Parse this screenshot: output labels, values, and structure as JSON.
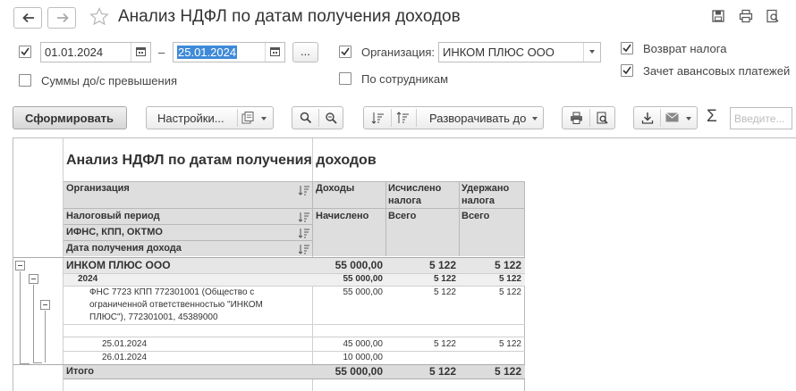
{
  "window": {
    "title": "Анализ НДФЛ по датам получения доходов"
  },
  "filters": {
    "period_enabled": true,
    "date_from": "01.01.2024",
    "date_separator": "–",
    "date_to": "25.01.2024",
    "more_button": "...",
    "org_enabled": true,
    "org_label": "Организация:",
    "org_value": "ИНКОМ ПЛЮС ООО",
    "return_tax_checked": true,
    "return_tax_label": "Возврат налога",
    "sums_excess_checked": false,
    "sums_excess_label": "Суммы до/с превышения",
    "by_employees_checked": false,
    "by_employees_label": "По сотрудникам",
    "advance_offset_checked": true,
    "advance_offset_label": "Зачет авансовых платежей"
  },
  "toolbar": {
    "generate": "Сформировать",
    "settings": "Настройки...",
    "expand": "Разворачивать до",
    "search_placeholder": "Введите..."
  },
  "report": {
    "title": "Анализ НДФЛ по датам получения доходов",
    "headers": {
      "organization": "Организация",
      "tax_period": "Налоговый период",
      "ifns": "ИФНС, КПП, ОКТМО",
      "income_date": "Дата получения дохода",
      "income": "Доходы",
      "accrued": "Начислено",
      "calculated_l1": "Исчислено",
      "calculated_l2": "налога",
      "calculated_total": "Всего",
      "withheld_l1": "Удержано",
      "withheld_l2": "налога",
      "withheld_total": "Всего"
    },
    "rows": [
      {
        "label": "ИНКОМ ПЛЮС ООО",
        "income": "55 000,00",
        "calc": "5 122",
        "withheld": "5 122"
      },
      {
        "label": "2024",
        "income": "55 000,00",
        "calc": "5 122",
        "withheld": "5 122"
      },
      {
        "label_l1": "ФНС 7723 КПП 772301001 (Общество с",
        "label_l2": "ограниченной ответственностью \"ИНКОМ",
        "label_l3": "ПЛЮС\"), 772301001, 45389000",
        "income": "55 000,00",
        "calc": "5 122",
        "withheld": "5 122"
      },
      {
        "label": "25.01.2024",
        "income": "45 000,00",
        "calc": "5 122",
        "withheld": "5 122"
      },
      {
        "label": "26.01.2024",
        "income": "10 000,00",
        "calc": "",
        "withheld": ""
      }
    ],
    "total": {
      "label": "Итого",
      "income": "55 000,00",
      "calc": "5 122",
      "withheld": "5 122"
    }
  }
}
